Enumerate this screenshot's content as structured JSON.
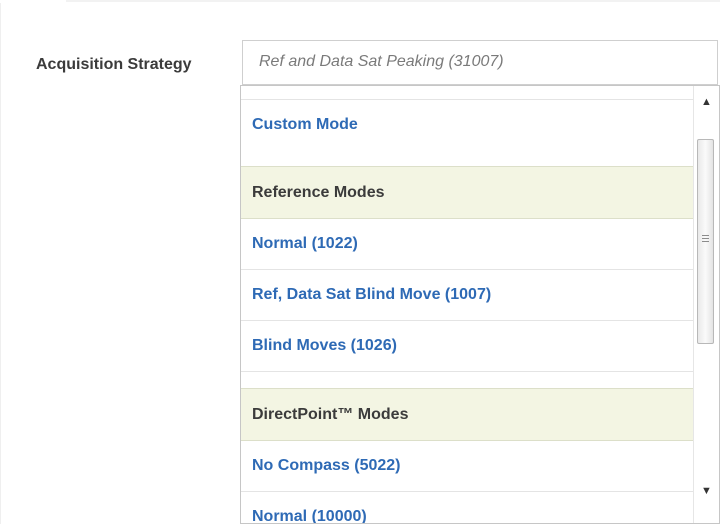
{
  "form": {
    "acquisition_label": "Acquisition Strategy",
    "acquisition_value": "Ref and Data Sat Peaking (31007)"
  },
  "dropdown": {
    "custom_mode": "Custom Mode",
    "reference_group": {
      "header": "Reference Modes",
      "options": [
        "Normal (1022)",
        "Ref, Data Sat Blind Move (1007)",
        "Blind Moves (1026)"
      ]
    },
    "directpoint_group": {
      "header": "DirectPoint™ Modes",
      "options": [
        "No Compass (5022)",
        "Normal (10000)"
      ]
    }
  },
  "icons": {
    "scroll_up": "up-arrow-icon",
    "scroll_down": "down-arrow-icon",
    "scroll_grip": "grip-icon"
  }
}
